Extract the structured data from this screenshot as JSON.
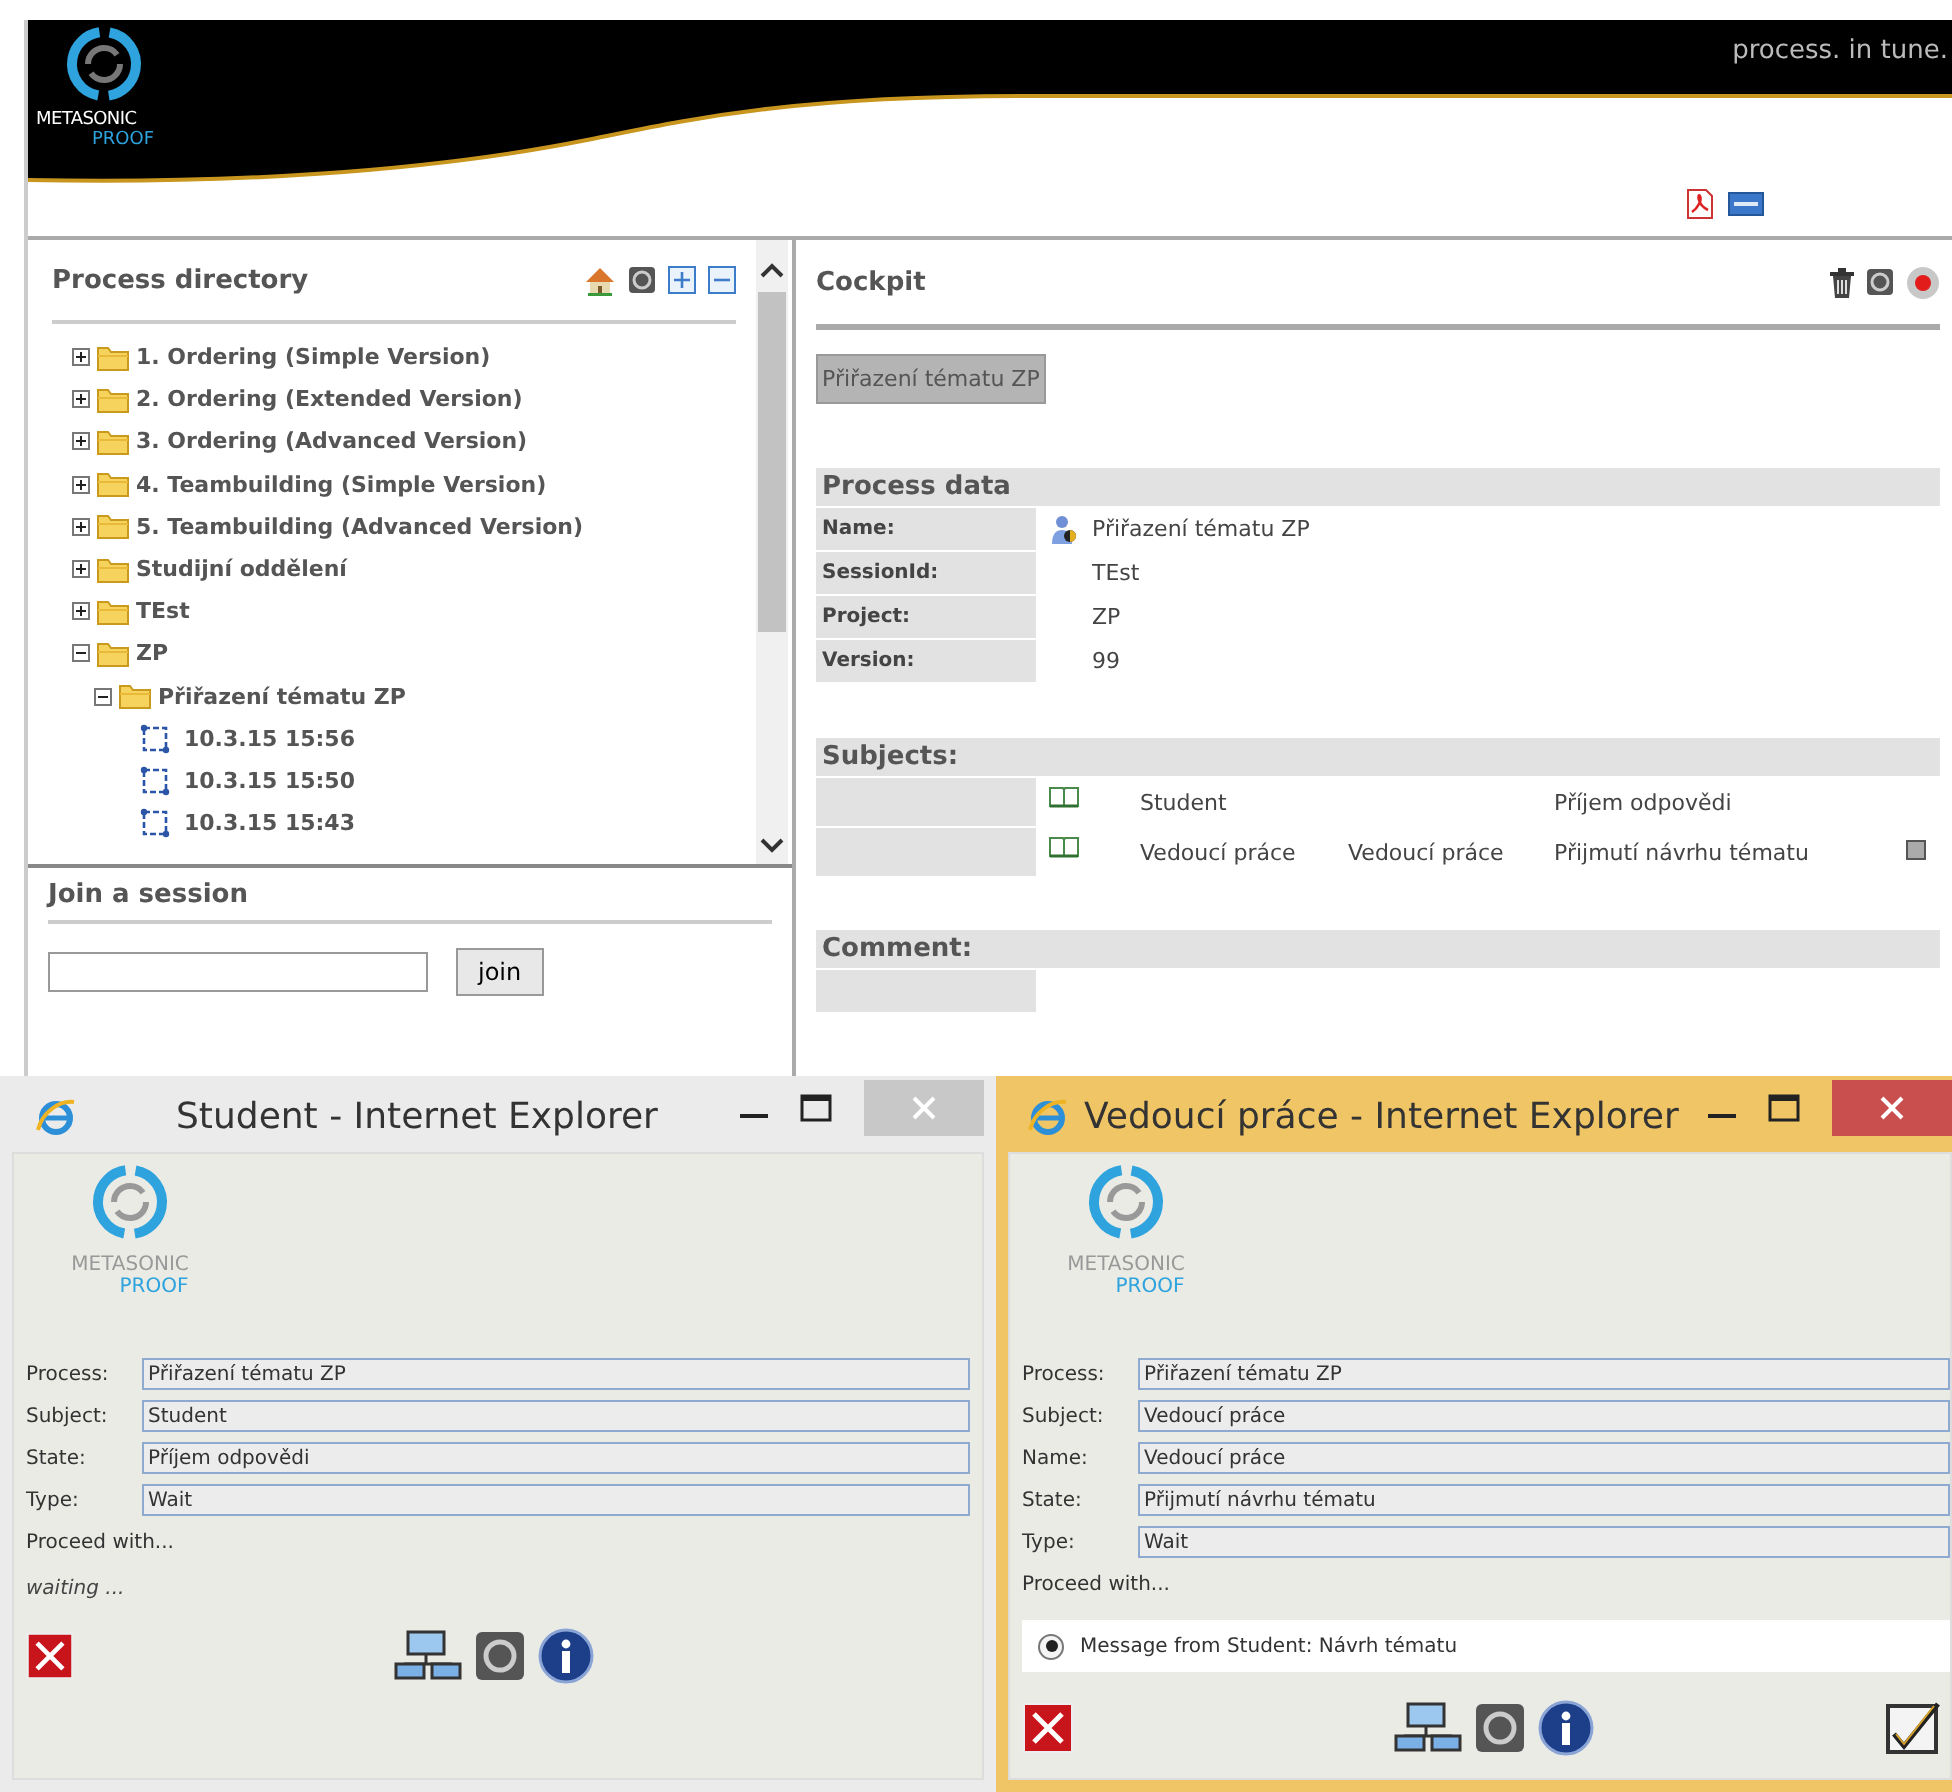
{
  "header": {
    "logo_top": "METASONIC",
    "logo_bottom": "PROOF",
    "tagline": "process. in tune."
  },
  "process_directory": {
    "title": "Process directory",
    "tree": [
      {
        "label": "1. Ordering (Simple Version)",
        "kind": "folder",
        "expanded": false
      },
      {
        "label": "2. Ordering (Extended Version)",
        "kind": "folder",
        "expanded": false
      },
      {
        "label": "3. Ordering (Advanced Version)",
        "kind": "folder",
        "expanded": false
      },
      {
        "label": "4. Teambuilding (Simple Version)",
        "kind": "folder",
        "expanded": false
      },
      {
        "label": "5. Teambuilding (Advanced Version)",
        "kind": "folder",
        "expanded": false
      },
      {
        "label": "Studijní oddělení",
        "kind": "folder",
        "expanded": false
      },
      {
        "label": "TEst",
        "kind": "folder",
        "expanded": false
      },
      {
        "label": "ZP",
        "kind": "folder",
        "expanded": true,
        "children": [
          {
            "label": "Přiřazení tématu ZP",
            "kind": "folder",
            "expanded": true,
            "children": [
              {
                "label": "10.3.15 15:56",
                "kind": "session"
              },
              {
                "label": "10.3.15 15:50",
                "kind": "session"
              },
              {
                "label": "10.3.15 15:43",
                "kind": "session"
              }
            ]
          }
        ]
      }
    ]
  },
  "join_session": {
    "title": "Join a session",
    "button": "join"
  },
  "cockpit": {
    "title": "Cockpit",
    "process_tab": "Přiřazení tématu ZP",
    "process_data_title": "Process data",
    "process_data": [
      {
        "label": "Name:",
        "value": "Přiřazení tématu ZP",
        "kind": "person"
      },
      {
        "label": "SessionId:",
        "value": "TEst",
        "kind": "plain"
      },
      {
        "label": "Project:",
        "value": "ZP",
        "kind": "plain"
      },
      {
        "label": "Version:",
        "value": "99",
        "kind": "plain"
      }
    ],
    "subjects_title": "Subjects:",
    "subjects": [
      {
        "subject": "Student",
        "state": "Příjem odpovědi",
        "marked": false
      },
      {
        "subject": "Vedoucí práce",
        "name": "Vedoucí práce",
        "state": "Přijmutí návrhu tématu",
        "marked": true
      }
    ],
    "comment_title": "Comment:"
  },
  "windows": [
    {
      "title": "Student - Internet Explorer",
      "active": false,
      "logo_top": "METASONIC",
      "logo_bottom": "PROOF",
      "fields": [
        {
          "label": "Process:",
          "value": "Přiřazení tématu ZP"
        },
        {
          "label": "Subject:",
          "value": "Student"
        },
        {
          "label": "State:",
          "value": "Příjem odpovědi"
        },
        {
          "label": "Type:",
          "value": "Wait"
        }
      ],
      "proceed_label": "Proceed with...",
      "waiting": "waiting ...",
      "submit_button": false
    },
    {
      "title": "Vedoucí práce - Internet Explorer",
      "active": true,
      "logo_top": "METASONIC",
      "logo_bottom": "PROOF",
      "fields": [
        {
          "label": "Process:",
          "value": "Přiřazení tématu ZP"
        },
        {
          "label": "Subject:",
          "value": "Vedoucí práce"
        },
        {
          "label": "Name:",
          "value": "Vedoucí práce"
        },
        {
          "label": "State:",
          "value": "Přijmutí návrhu tématu"
        },
        {
          "label": "Type:",
          "value": "Wait"
        }
      ],
      "proceed_label": "Proceed with...",
      "messages": [
        {
          "label": "Message from Student: Návrh tématu",
          "selected": true
        }
      ],
      "submit_button": true
    }
  ]
}
